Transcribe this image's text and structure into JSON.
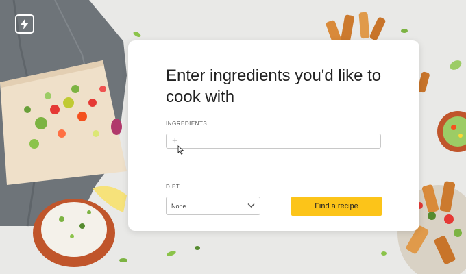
{
  "app": {
    "logo_icon": "lightning-bolt-icon"
  },
  "form": {
    "title": "Enter ingredients you'd like to cook with",
    "ingredients_label": "INGREDIENTS",
    "ingredients_value": "",
    "add_icon": "plus-icon",
    "diet_label": "DIET",
    "diet_selected": "None",
    "submit_label": "Find a recipe"
  },
  "colors": {
    "accent": "#fcc419",
    "card": "#ffffff",
    "background": "#e9e9e7"
  }
}
